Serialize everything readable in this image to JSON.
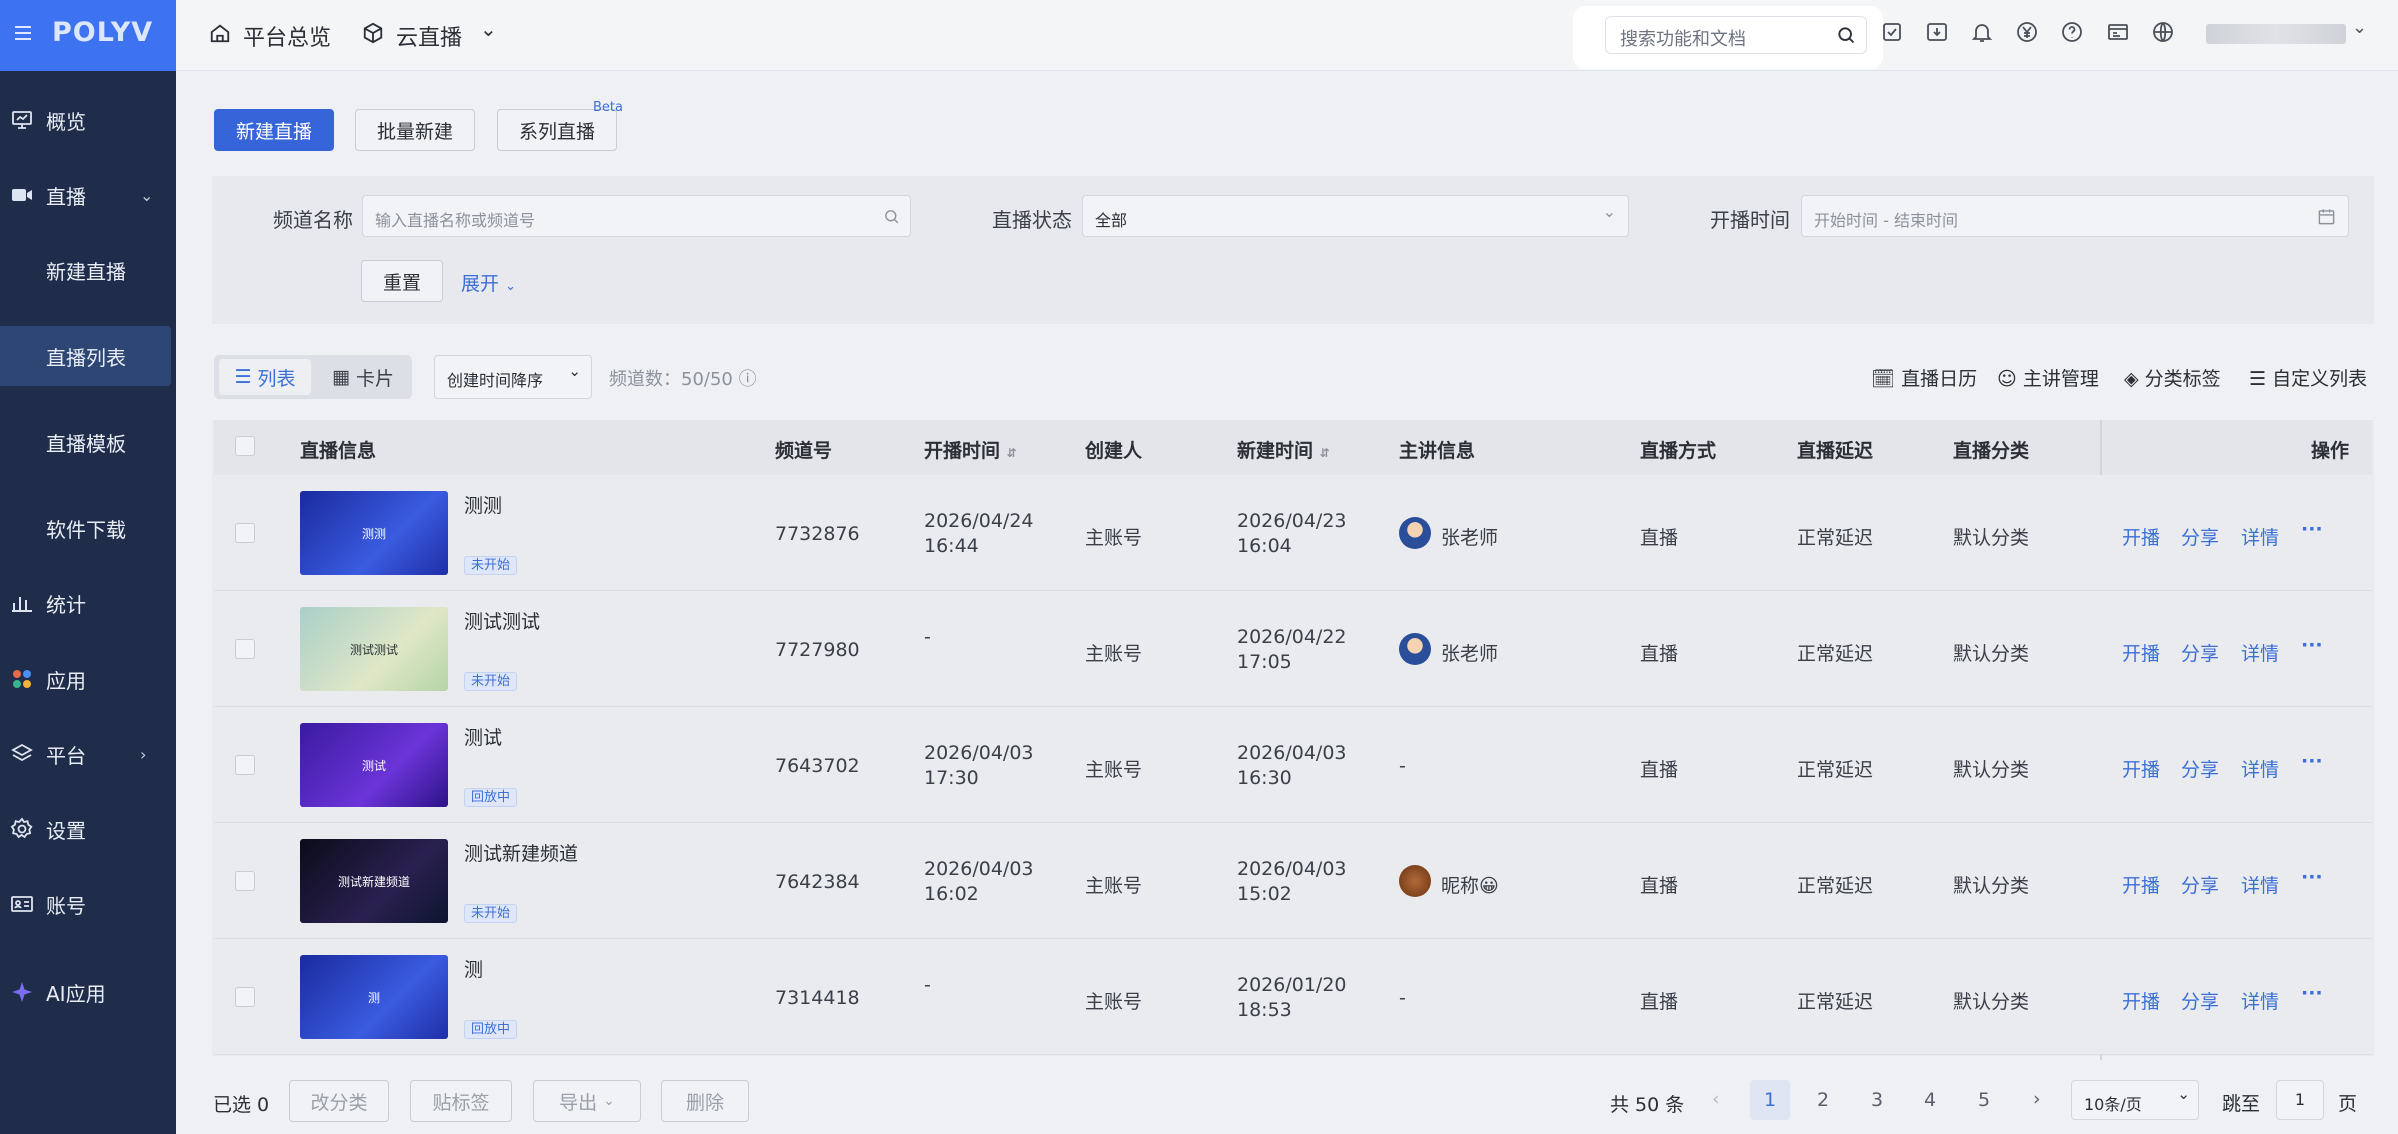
{
  "brand": {
    "logo": "POLYV",
    "accent": "#3665d9",
    "sidebar_bg": "#1f2d4a"
  },
  "sidebar": {
    "items": [
      {
        "label": "概览",
        "icon": "monitor-icon"
      },
      {
        "label": "直播",
        "icon": "video-camera-icon",
        "chevron": "chevron-down-icon"
      },
      {
        "label": "新建直播"
      },
      {
        "label": "直播列表",
        "active": true
      },
      {
        "label": "直播模板"
      },
      {
        "label": "软件下载"
      },
      {
        "label": "统计",
        "icon": "bar-chart-icon"
      },
      {
        "label": "应用",
        "icon": "apps-icon"
      },
      {
        "label": "平台",
        "icon": "layers-icon",
        "chevron": "chevron-right-icon"
      },
      {
        "label": "设置",
        "icon": "gear-icon"
      },
      {
        "label": "账号",
        "icon": "id-card-icon"
      },
      {
        "label": "AI应用",
        "icon": "sparkle-icon"
      }
    ]
  },
  "topbar": {
    "home": "平台总览",
    "product": "云直播",
    "search_placeholder": "搜索功能和文档"
  },
  "toolbar": {
    "new_live": "新建直播",
    "batch_new": "批量新建",
    "series_live": "系列直播",
    "beta": "Beta"
  },
  "filters": {
    "channel_label": "频道名称",
    "channel_placeholder": "输入直播名称或频道号",
    "status_label": "直播状态",
    "status_value": "全部",
    "time_label": "开播时间",
    "time_placeholder": "开始时间 - 结束时间",
    "reset": "重置",
    "expand": "展开"
  },
  "view": {
    "list": "列表",
    "card": "卡片",
    "sort": "创建时间降序",
    "count": "频道数：50/50"
  },
  "right_tools": {
    "calendar": "直播日历",
    "lecturer": "主讲管理",
    "tags": "分类标签",
    "custom": "自定义列表"
  },
  "columns": [
    "直播信息",
    "频道号",
    "开播时间",
    "创建人",
    "新建时间",
    "主讲信息",
    "直播方式",
    "直播延迟",
    "直播分类",
    "操作"
  ],
  "rows": [
    {
      "title": "测测",
      "thumb_text": "测测",
      "status": "未开始",
      "channel": "7732876",
      "start_date": "2026/04/24",
      "start_time": "16:44",
      "creator": "主账号",
      "created_date": "2026/04/23",
      "created_time": "16:04",
      "lecturer": "张老师",
      "mode": "直播",
      "delay": "正常延迟",
      "category": "默认分类",
      "thumb_color": "#2e3fb8"
    },
    {
      "title": "测试测试",
      "thumb_text": "测试测试",
      "status": "未开始",
      "channel": "7727980",
      "start_date": "-",
      "start_time": "",
      "creator": "主账号",
      "created_date": "2026/04/22",
      "created_time": "17:05",
      "lecturer": "张老师",
      "mode": "直播",
      "delay": "正常延迟",
      "category": "默认分类",
      "thumb_color": "#bcd3c6"
    },
    {
      "title": "测试",
      "thumb_text": "测试",
      "status": "回放中",
      "channel": "7643702",
      "start_date": "2026/04/03",
      "start_time": "17:30",
      "creator": "主账号",
      "created_date": "2026/04/03",
      "created_time": "16:30",
      "lecturer": "-",
      "mode": "直播",
      "delay": "正常延迟",
      "category": "默认分类",
      "thumb_color": "#4b22b0"
    },
    {
      "title": "测试新建频道",
      "thumb_text": "测试新建频道",
      "status": "未开始",
      "channel": "7642384",
      "start_date": "2026/04/03",
      "start_time": "16:02",
      "creator": "主账号",
      "created_date": "2026/04/03",
      "created_time": "15:02",
      "lecturer": "昵称😀",
      "mode": "直播",
      "delay": "正常延迟",
      "category": "默认分类",
      "thumb_color": "#121428"
    },
    {
      "title": "测",
      "thumb_text": "测",
      "status": "回放中",
      "channel": "7314418",
      "start_date": "-",
      "start_time": "",
      "creator": "主账号",
      "created_date": "2026/01/20",
      "created_time": "18:53",
      "lecturer": "-",
      "mode": "直播",
      "delay": "正常延迟",
      "category": "默认分类",
      "thumb_color": "#2e3fb8"
    }
  ],
  "actions": {
    "start": "开播",
    "share": "分享",
    "detail": "详情",
    "more": "···"
  },
  "footer": {
    "selected": "已选 0",
    "change_cat": "改分类",
    "tag": "贴标签",
    "export": "导出",
    "delete": "删除",
    "total": "共 50 条",
    "pages": [
      "1",
      "2",
      "3",
      "4",
      "5"
    ],
    "page_size": "10条/页",
    "jump": "跳至",
    "jump_value": "1",
    "page_unit": "页"
  }
}
